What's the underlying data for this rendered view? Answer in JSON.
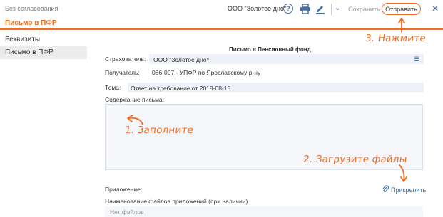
{
  "header": {
    "status": "Без согласования",
    "document_title": "Письмо в ПФР",
    "organization": "ООО \"Золотое дно\"",
    "help_icon": "question-circle-icon",
    "print_icon": "printer-icon",
    "edit_icon": "pen-icon",
    "dropdown_icon": "chevron-down-icon",
    "save_label": "Сохранить",
    "send_label": "Отправить",
    "close_icon": "close-icon",
    "accent_color": "#f26b21"
  },
  "sidebar": {
    "items": [
      {
        "label": "Реквизиты",
        "selected": false
      },
      {
        "label": "Письмо в ПФР",
        "selected": true
      }
    ]
  },
  "form": {
    "title": "Письмо в Пенсионный фонд",
    "insurer_label": "Страхователь:",
    "insurer_value": "ООО \"Золотое дно\"",
    "recipient_label": "Получатель:",
    "recipient_value": "086-007 - УПФР по Ярославскому р-ну",
    "subject_label": "Тема:",
    "subject_value": "Ответ на требование  от 2018-08-15",
    "body_label": "Содержание письма:",
    "body_value": "",
    "attachment_label": "Приложение:",
    "attach_link": "Прикрепить",
    "attachment_names_label": "Наименование файлов приложений (при наличии)",
    "attachment_names_value": "Нет файлов"
  },
  "annotations": {
    "step1": "1. Заполните",
    "step2": "2. Загрузите файлы",
    "step3": "3. Нажмите"
  }
}
